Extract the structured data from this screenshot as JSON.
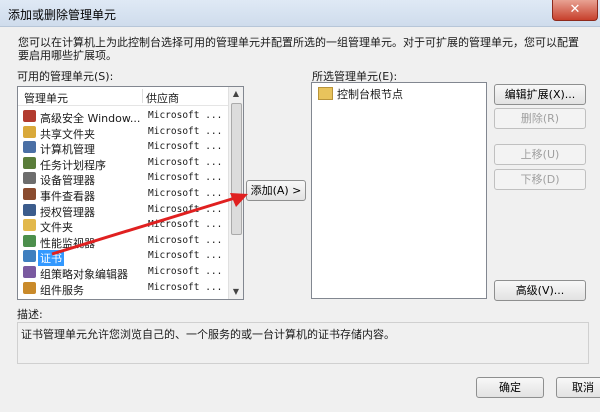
{
  "window": {
    "title": "添加或删除管理单元",
    "close_glyph": "✕"
  },
  "description": "您可以在计算机上为此控制台选择可用的管理单元并配置所选的一组管理单元。对于可扩展的管理单元，您可以配置要启用哪些扩展项。",
  "available": {
    "label": "可用的管理单元(S):",
    "col_name": "管理单元",
    "col_vendor": "供应商",
    "items": [
      {
        "name": "高级安全 Window...",
        "vendor": "Microsoft ...",
        "icon": "firewall-icon",
        "color": "#b23b2e"
      },
      {
        "name": "共享文件夹",
        "vendor": "Microsoft ...",
        "icon": "shared-folder-icon",
        "color": "#d9a93a"
      },
      {
        "name": "计算机管理",
        "vendor": "Microsoft ...",
        "icon": "computer-management-icon",
        "color": "#4a6fa5"
      },
      {
        "name": "任务计划程序",
        "vendor": "Microsoft ...",
        "icon": "task-scheduler-icon",
        "color": "#5a7d3a"
      },
      {
        "name": "设备管理器",
        "vendor": "Microsoft ...",
        "icon": "device-manager-icon",
        "color": "#6d6d6d"
      },
      {
        "name": "事件查看器",
        "vendor": "Microsoft ...",
        "icon": "event-viewer-icon",
        "color": "#8a4b2e"
      },
      {
        "name": "授权管理器",
        "vendor": "Microsoft ...",
        "icon": "authorization-manager-icon",
        "color": "#3b5c8c"
      },
      {
        "name": "文件夹",
        "vendor": "Microsoft ...",
        "icon": "folder-icon",
        "color": "#e2b84b"
      },
      {
        "name": "性能监视器",
        "vendor": "Microsoft ...",
        "icon": "performance-monitor-icon",
        "color": "#4c8f4c"
      },
      {
        "name": "证书",
        "vendor": "Microsoft ...",
        "icon": "certificate-icon",
        "color": "#3f7fbf"
      },
      {
        "name": "组策略对象编辑器",
        "vendor": "Microsoft ...",
        "icon": "group-policy-icon",
        "color": "#7a5aa0"
      },
      {
        "name": "组件服务",
        "vendor": "Microsoft ...",
        "icon": "component-services-icon",
        "color": "#c98a2a"
      }
    ]
  },
  "add_button": "添加(A) >",
  "selected": {
    "label": "所选管理单元(E):",
    "root": "控制台根节点"
  },
  "side_buttons": {
    "edit_ext": "编辑扩展(X)...",
    "remove": "删除(R)",
    "move_up": "上移(U)",
    "move_down": "下移(D)",
    "advanced": "高级(V)..."
  },
  "desc_section": {
    "label": "描述:",
    "text": "证书管理单元允许您浏览自己的、一个服务的或一台计算机的证书存储内容。"
  },
  "footer": {
    "ok": "确定",
    "cancel": "取消"
  },
  "colors": {
    "selection": "#3399ff",
    "annotation": "#e02020"
  }
}
